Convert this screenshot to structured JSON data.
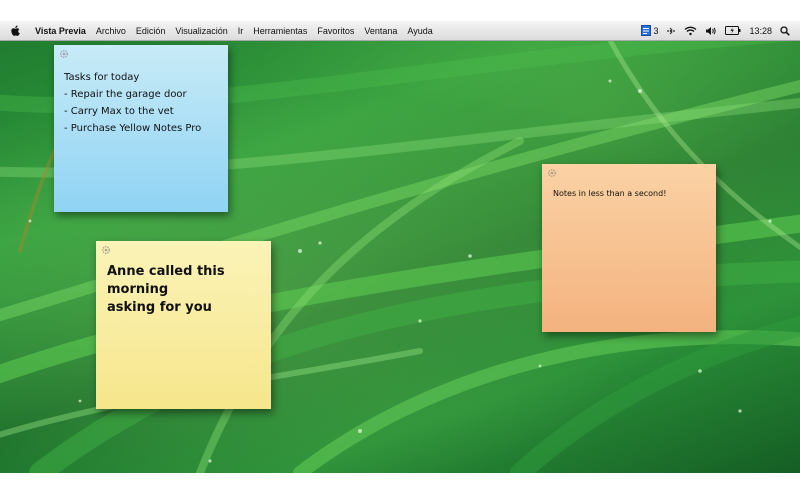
{
  "menubar": {
    "items": [
      "Vista Previa",
      "Archivo",
      "Edición",
      "Visualización",
      "Ir",
      "Herramientas",
      "Favoritos",
      "Ventana",
      "Ayuda"
    ],
    "status": {
      "notification_count": "3",
      "clock": "13:28"
    }
  },
  "notes": {
    "blue": {
      "text": "Tasks for today\n- Repair the garage door\n- Carry Max to the vet\n- Purchase Yellow Notes Pro",
      "color": "#a8def6"
    },
    "yellow": {
      "text": "Anne called this morning\nasking for you",
      "color": "#f8ec9f"
    },
    "orange": {
      "text": "Notes in less than a second!",
      "color": "#f7c291"
    }
  },
  "icons": [
    "apple-icon",
    "notes-status-icon",
    "bluetooth-icon",
    "wifi-icon",
    "volume-icon",
    "battery-icon",
    "spotlight-search-icon",
    "gear-icon"
  ]
}
